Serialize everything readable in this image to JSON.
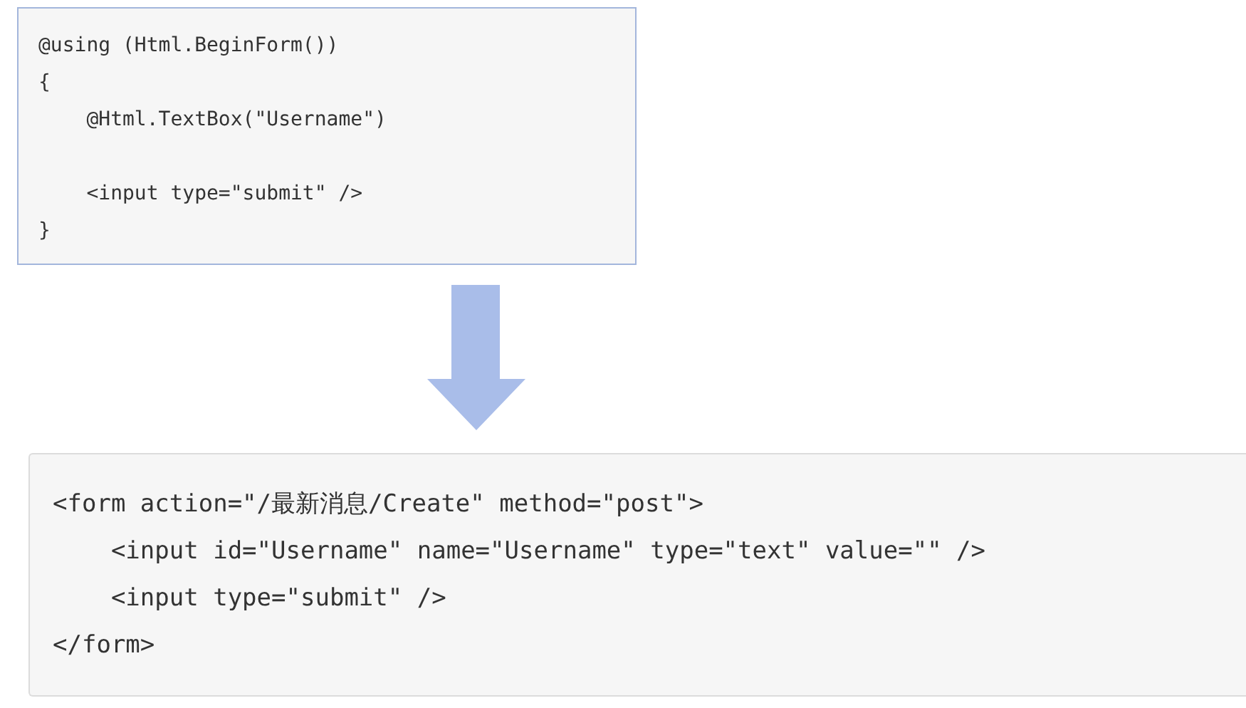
{
  "code_blocks": [
    {
      "kind": "razor",
      "groups": [
        [
          "@using (Html.BeginForm())",
          "{",
          "    @Html.TextBox(\"Username\")"
        ],
        [
          "    <input type=\"submit\" />",
          "}"
        ]
      ]
    },
    {
      "kind": "html",
      "groups": [
        [
          "<form action=\"/最新消息/Create\" method=\"post\">",
          "    <input id=\"Username\" name=\"Username\" type=\"text\" value=\"\" />",
          "    <input type=\"submit\" />",
          "</form>"
        ]
      ]
    }
  ]
}
